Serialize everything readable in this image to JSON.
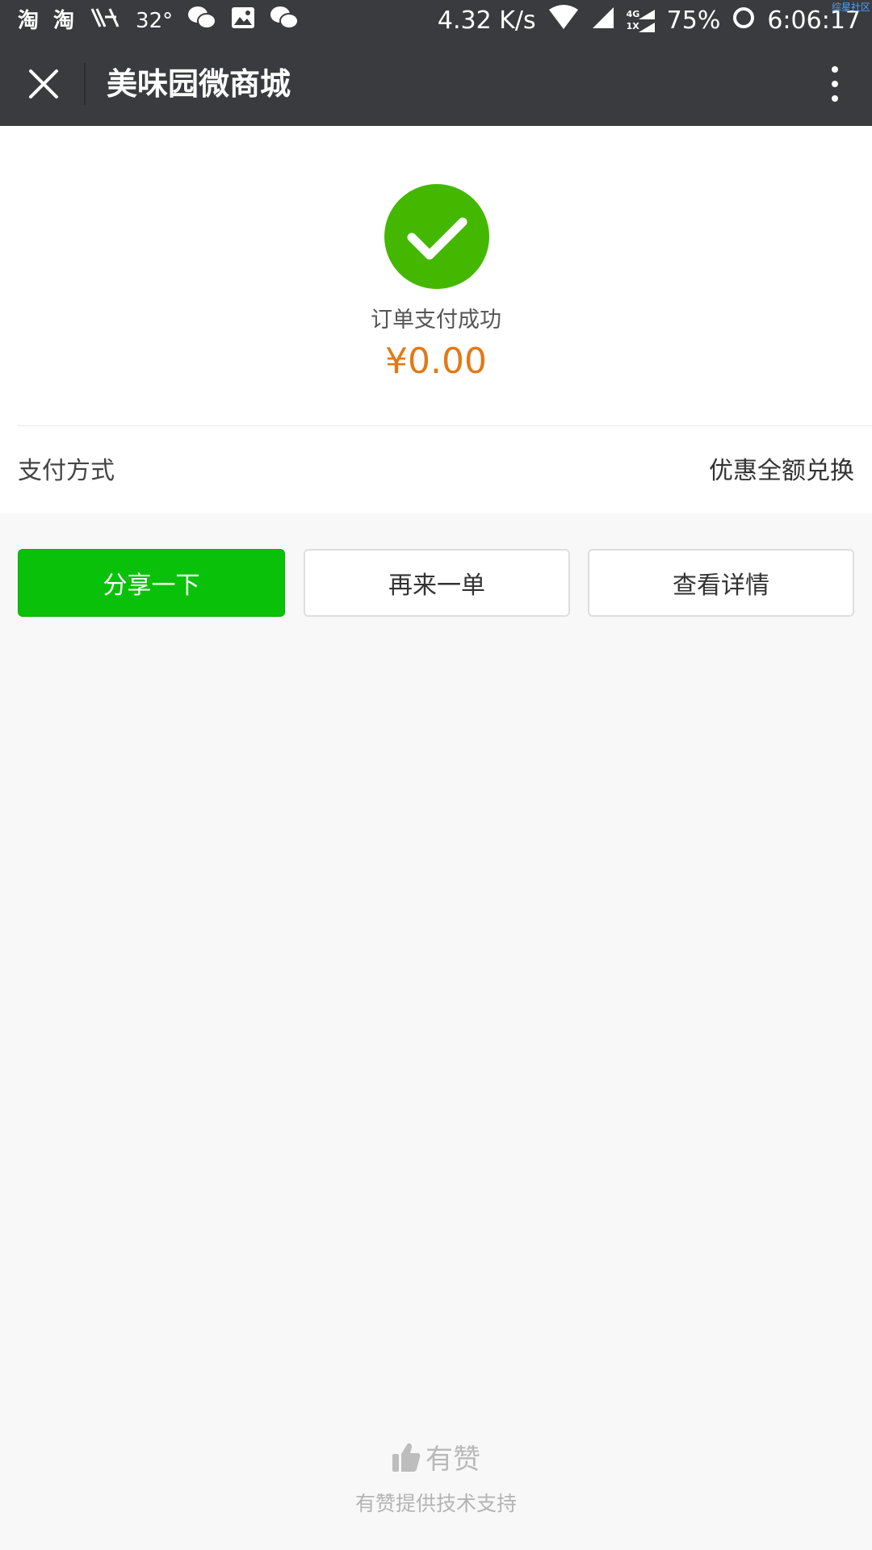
{
  "status_bar": {
    "app_icon_1": "淘",
    "app_icon_2": "淘",
    "temperature": "32°",
    "network_speed": "4.32 K/s",
    "signal_label_top": "4G",
    "signal_label_bottom": "1X",
    "battery": "75%",
    "time": "6:06:17",
    "watermark": "综星社区",
    "icons": [
      "taobao-icon",
      "taobao-icon",
      "weather-icon",
      "wechat-icon",
      "image-icon",
      "wechat-icon",
      "wifi-icon",
      "signal-icon",
      "signal-icon",
      "loading-icon"
    ]
  },
  "header": {
    "title": "美味园微商城",
    "close_icon": "close-icon",
    "more_icon": "more-vertical-icon"
  },
  "order": {
    "status_icon": "check-circle-icon",
    "status_text": "订单支付成功",
    "amount": "¥0.00",
    "payment_method_label": "支付方式",
    "payment_method_value": "优惠全额兑换"
  },
  "actions": {
    "share_label": "分享一下",
    "reorder_label": "再来一单",
    "details_label": "查看详情"
  },
  "footer": {
    "brand_icon": "thumbs-up-icon",
    "brand": "有赞",
    "support_text": "有赞提供技术支持"
  },
  "colors": {
    "header_bg": "#3a3b3f",
    "success_green": "#44b800",
    "primary_button": "#0ac10a",
    "amount_orange": "#e07a17",
    "page_bg": "#f8f8f8"
  }
}
